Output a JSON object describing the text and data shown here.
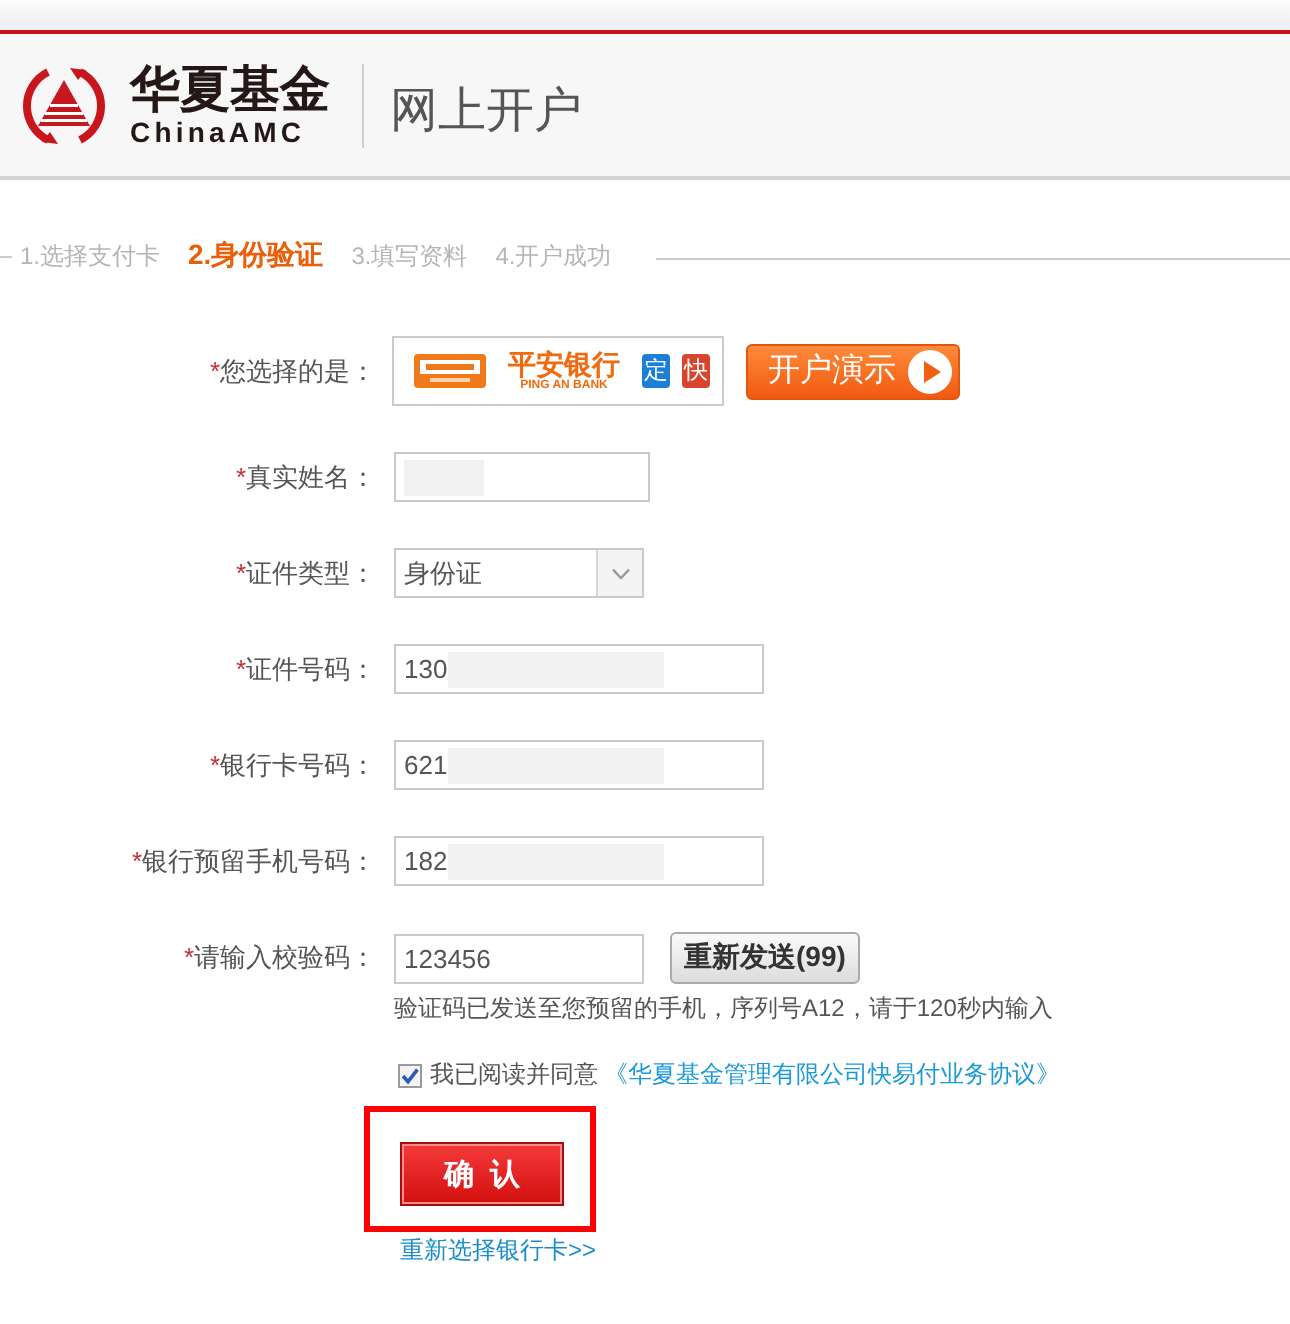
{
  "header": {
    "brand_cn": "华夏基金",
    "brand_en": "ChinaAMC",
    "title": "网上开户"
  },
  "steps": [
    {
      "label": "1.选择支付卡",
      "selected": false
    },
    {
      "label": "2.身份验证",
      "selected": true
    },
    {
      "label": "3.填写资料",
      "selected": false
    },
    {
      "label": "4.开户成功",
      "selected": false
    }
  ],
  "form": {
    "rows": [
      {
        "kind": "bank",
        "required_mark": "*",
        "label": "您选择的是：",
        "bank": {
          "name": "平安银行",
          "name_en": "PING AN BANK",
          "tags": [
            {
              "text": "定",
              "color": "#1b7fd6"
            },
            {
              "text": "快",
              "color": "#d9442c"
            }
          ]
        },
        "demo_button": "开户演示"
      },
      {
        "kind": "input",
        "required_mark": "*",
        "label": "真实姓名：",
        "redacted": true
      },
      {
        "kind": "select",
        "required_mark": "*",
        "label": "证件类型：",
        "value": "身份证"
      },
      {
        "kind": "input",
        "required_mark": "*",
        "label": "证件号码：",
        "value": "130",
        "redacted": true
      },
      {
        "kind": "input",
        "required_mark": "*",
        "label": "银行卡号码：",
        "value": "621",
        "redacted": true
      },
      {
        "kind": "input",
        "required_mark": "*",
        "label": "银行预留手机号码：",
        "value": "182",
        "redacted": true
      },
      {
        "kind": "code",
        "required_mark": "*",
        "label": "请输入校验码：",
        "value": "123456",
        "button": "重新发送(99)",
        "hint": "验证码已发送至您预留的手机，序列号A12，请于120秒内输入"
      }
    ]
  },
  "agreement": {
    "checked": true,
    "text": "我已阅读并同意",
    "link": "《华夏基金管理有限公司快易付业务协议》"
  },
  "confirm": {
    "label": "确认",
    "highlighted": true
  },
  "rechoose_link": "重新选择银行卡>>"
}
